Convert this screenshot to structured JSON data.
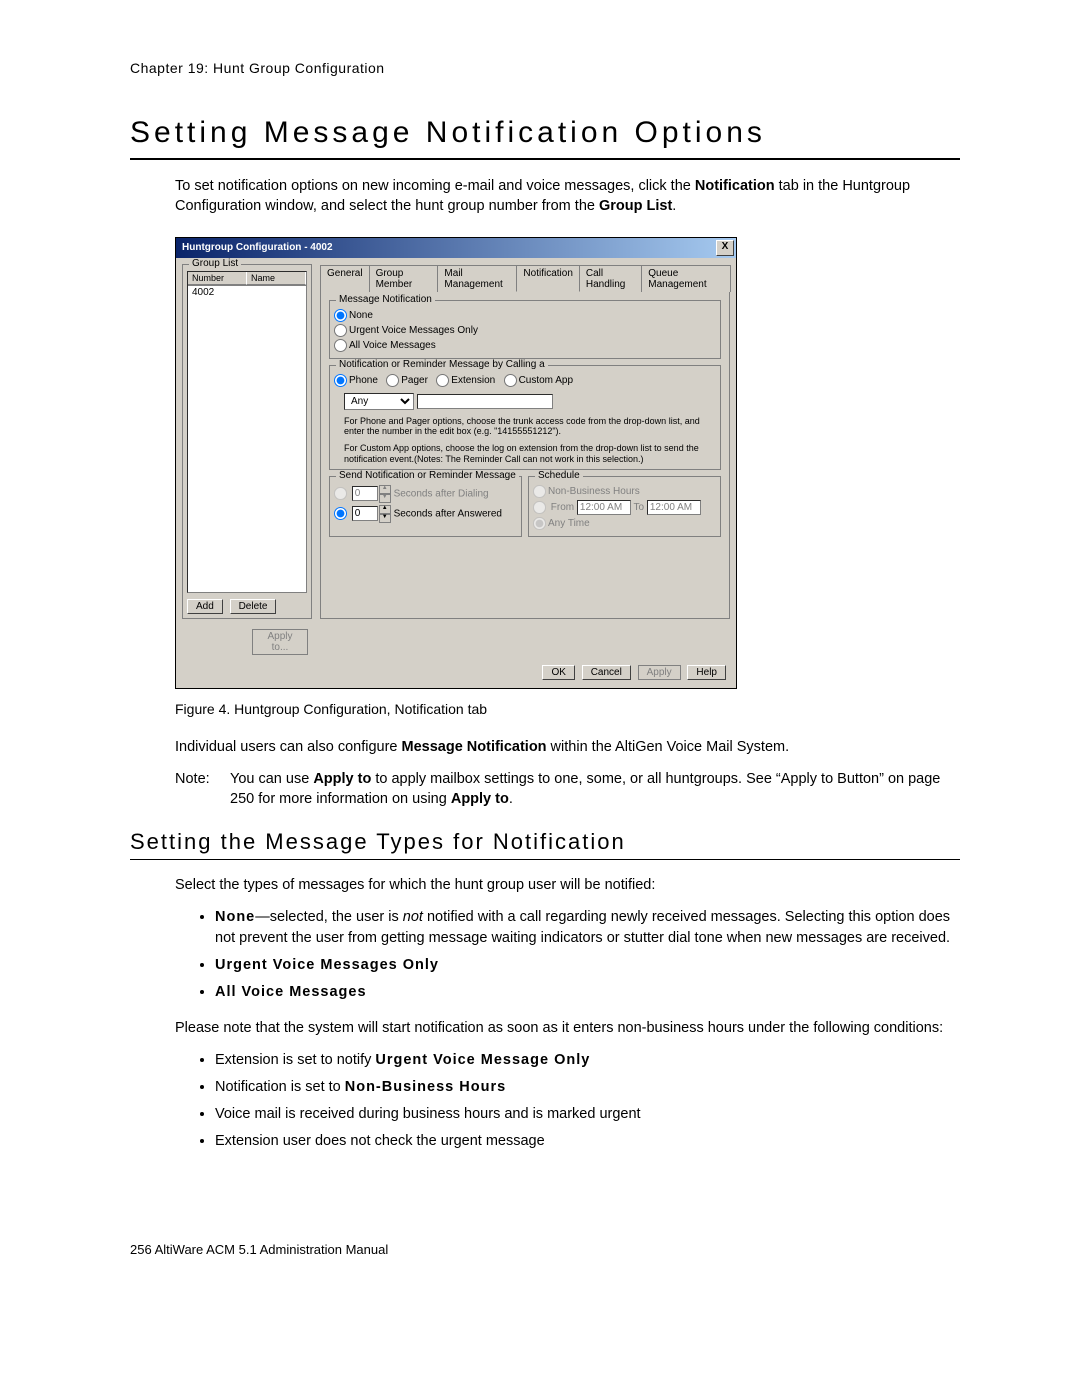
{
  "chapter": "Chapter 19:  Hunt Group Configuration",
  "h1": "Setting Message Notification Options",
  "intro_segments": {
    "a": "To set notification options on new incoming e-mail and voice messages, click the ",
    "b": "Notification",
    "c": " tab in the Huntgroup Configuration window, and select the hunt group number from the ",
    "d": "Group List",
    "e": "."
  },
  "dialog": {
    "title": "Huntgroup Configuration - 4002",
    "close_x": "X",
    "group_list": {
      "legend": "Group List",
      "col1": "Number",
      "col2": "Name",
      "row1": "4002",
      "add": "Add",
      "delete": "Delete"
    },
    "tabs": {
      "general": "General",
      "group_member": "Group Member",
      "mail_mgmt": "Mail Management",
      "notification": "Notification",
      "call_handling": "Call Handling",
      "queue_mgmt": "Queue Management"
    },
    "msg_notif": {
      "legend": "Message Notification",
      "none": "None",
      "urgent": "Urgent Voice Messages Only",
      "all": "All Voice Messages"
    },
    "calling": {
      "legend": "Notification or Reminder Message by Calling a",
      "phone": "Phone",
      "pager": "Pager",
      "extension": "Extension",
      "custom": "Custom App",
      "any": "Any",
      "help1": "For Phone and Pager options, choose the trunk access code from the drop-down list, and enter the number in the edit box (e.g. \"14155551212\").",
      "help2": "For Custom App options, choose the log on extension from the drop-down list to send the notification event.(Notes: The Reminder Call can not work in this selection.)"
    },
    "send": {
      "legend": "Send Notification or Reminder Message",
      "seconds_dialing": "Seconds after Dialing",
      "seconds_answered": "Seconds after Answered",
      "val0": "0"
    },
    "schedule": {
      "legend": "Schedule",
      "nbh": "Non-Business Hours",
      "from": "From",
      "to": "To",
      "t1": "12:00 AM",
      "t2": "12:00 AM",
      "anytime": "Any Time"
    },
    "apply_to": "Apply to...",
    "ok": "OK",
    "cancel": "Cancel",
    "apply": "Apply",
    "help": "Help"
  },
  "figcap": "Figure 4.    Huntgroup Configuration, Notification tab",
  "after1a": "Individual users can also configure ",
  "after1b": "Message Notification",
  "after1c": " within the AltiGen Voice Mail System.",
  "note_label": "Note:",
  "note_a": "You can use ",
  "note_b": "Apply to",
  "note_c": " to apply mailbox settings to one, some, or all huntgroups. See “Apply to Button” on page 250 for more information on using ",
  "note_d": "Apply to",
  "note_e": ".",
  "h2": "Setting the Message Types for Notification",
  "p_sel": "Select the types of messages for which the hunt group user will be notified:",
  "bullets1": {
    "none_b": "None",
    "none_rest_a": "—selected, the user is ",
    "none_rest_em": "not",
    "none_rest_b": " notified with a call regarding newly received messages. Selecting this option does not prevent the user from getting message waiting indicators or stutter dial tone when new messages are received.",
    "urgent_b": "Urgent Voice Messages Only",
    "all_b": "All Voice Messages"
  },
  "p_note2": "Please note that the system will start notification as soon as it enters non-business hours under the following conditions:",
  "bullets2": {
    "l1a": "Extension is set to notify ",
    "l1b": "Urgent Voice Message Only",
    "l2a": "Notification is set to ",
    "l2b": "Non-Business Hours",
    "l3": "Voice mail is received during business hours and is marked urgent",
    "l4": "Extension user does not check the urgent message"
  },
  "footer_a": "256",
  "footer_b": "    AltiWare ACM 5.1 Administration Manual"
}
